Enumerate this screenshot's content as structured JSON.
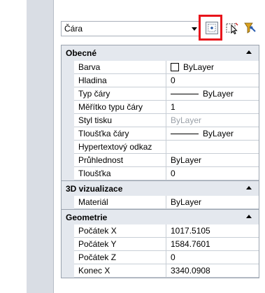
{
  "toolbar": {
    "object_type": "Čára"
  },
  "icons": {
    "close": "close-icon",
    "autohide": "autohide-icon",
    "properties": "properties-icon",
    "quick_select": "quick-select-icon",
    "select_objects": "select-objects-icon",
    "pickadd": "pickadd-icon"
  },
  "colors": {
    "highlight": "#e8141b",
    "category_bg": "#e4e8ee",
    "strip_bg": "#d9dde4"
  },
  "categories": [
    {
      "title": "Obecné",
      "rows": [
        {
          "name": "Barva",
          "value": "ByLayer",
          "kind": "checkbox"
        },
        {
          "name": "Hladina",
          "value": "0"
        },
        {
          "name": "Typ čáry",
          "value": "ByLayer",
          "kind": "line"
        },
        {
          "name": "Měřítko typu čáry",
          "value": "1"
        },
        {
          "name": "Styl tisku",
          "value": "ByLayer",
          "kind": "disabled"
        },
        {
          "name": "Tloušťka čáry",
          "value": "ByLayer",
          "kind": "line"
        },
        {
          "name": "Hypertextový odkaz",
          "value": ""
        },
        {
          "name": "Průhlednost",
          "value": "ByLayer"
        },
        {
          "name": "Tloušťka",
          "value": "0"
        }
      ]
    },
    {
      "title": "3D vizualizace",
      "rows": [
        {
          "name": "Materiál",
          "value": "ByLayer"
        }
      ]
    },
    {
      "title": "Geometrie",
      "rows": [
        {
          "name": "Počátek X",
          "value": "1017.5105"
        },
        {
          "name": "Počátek Y",
          "value": "1584.7601"
        },
        {
          "name": "Počátek Z",
          "value": "0"
        },
        {
          "name": "Konec X",
          "value": "3340.0908"
        }
      ]
    }
  ]
}
